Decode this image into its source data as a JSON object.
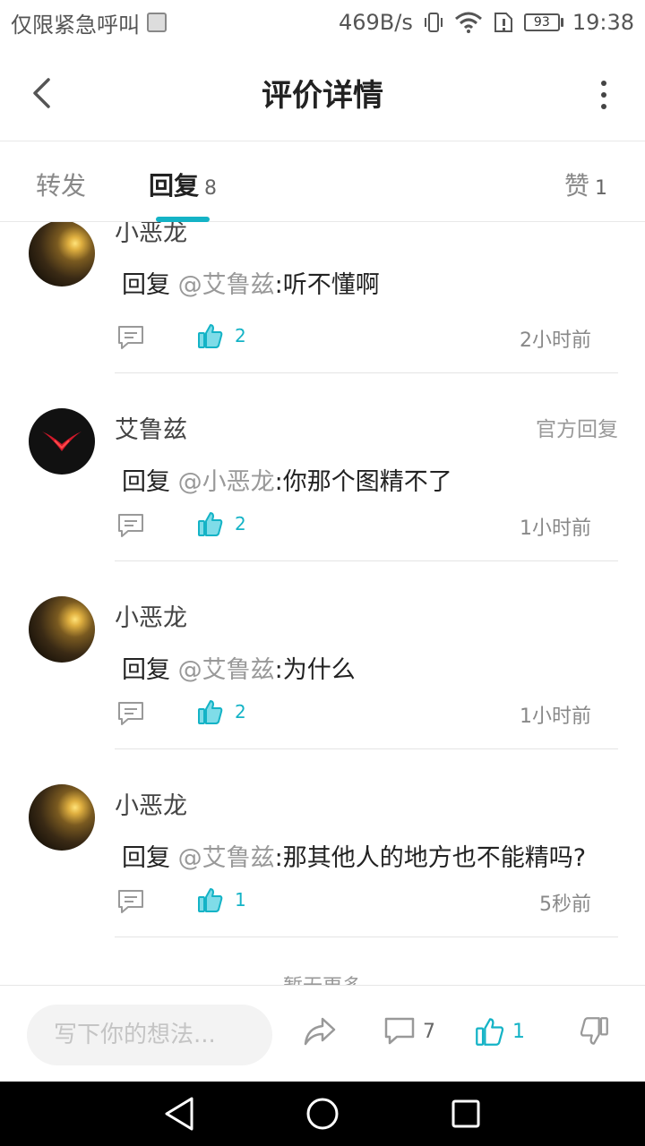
{
  "status_bar": {
    "carrier": "仅限紧急呼叫",
    "network_speed": "469B/s",
    "battery": "93",
    "time": "19:38"
  },
  "header": {
    "title": "评价详情"
  },
  "tabs": [
    {
      "label": "转发",
      "count": ""
    },
    {
      "label": "回复",
      "count": "8"
    },
    {
      "label": "赞",
      "count": "1"
    }
  ],
  "comments": [
    {
      "username": "小恶龙",
      "prefix": "回复 ",
      "mention": "@艾鲁兹",
      "text": ":听不懂啊",
      "likes": "2",
      "time": "2小时前",
      "official": ""
    },
    {
      "username": "艾鲁兹",
      "prefix": "回复 ",
      "mention": "@小恶龙",
      "text": ":你那个图精不了",
      "likes": "2",
      "time": "1小时前",
      "official": "官方回复"
    },
    {
      "username": "小恶龙",
      "prefix": "回复 ",
      "mention": "@艾鲁兹",
      "text": ":为什么",
      "likes": "2",
      "time": "1小时前",
      "official": ""
    },
    {
      "username": "小恶龙",
      "prefix": "回复 ",
      "mention": "@艾鲁兹",
      "text": ":那其他人的地方也不能精吗?",
      "likes": "1",
      "time": "5秒前",
      "official": ""
    }
  ],
  "no_more": "暂无更多",
  "bottom_bar": {
    "input_placeholder": "写下你的想法...",
    "comment_count": "7",
    "like_count": "1"
  },
  "colors": {
    "accent": "#14b3c6"
  }
}
